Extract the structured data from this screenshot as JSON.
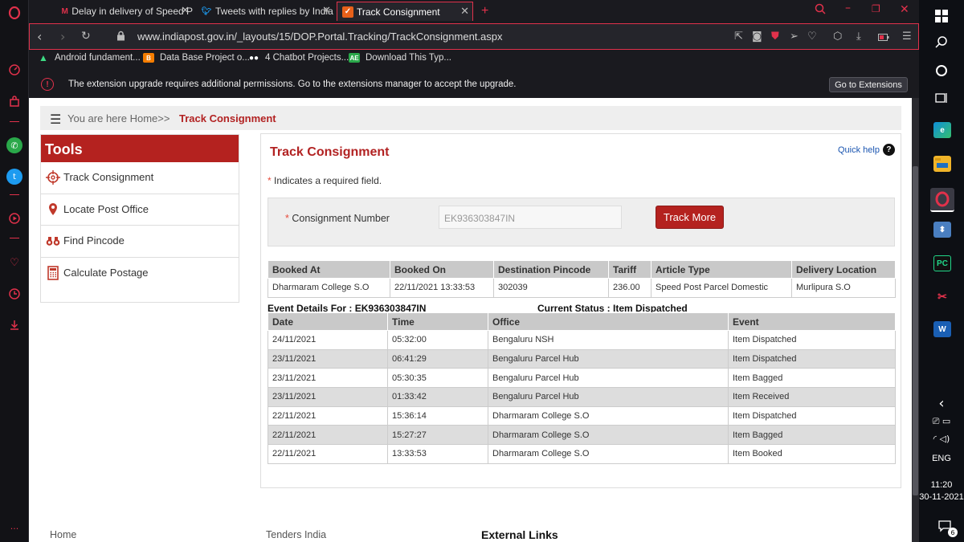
{
  "colors": {
    "accent": "#e1314b",
    "brand_red": "#b4221f",
    "link_blue": "#1a55b0"
  },
  "tabs": [
    {
      "label": "Delay in delivery of Speed P",
      "icon": "gmail-icon"
    },
    {
      "label": "Tweets with replies by India",
      "icon": "twitter-icon"
    },
    {
      "label": "Track Consignment",
      "icon": "indiapost-icon"
    }
  ],
  "address": {
    "url": "www.indiapost.gov.in/_layouts/15/DOP.Portal.Tracking/TrackConsignment.aspx"
  },
  "bookmarks": [
    {
      "label": "Android fundament...",
      "icon": "android-icon"
    },
    {
      "label": "Data Base Project o...",
      "icon": "blogger-icon"
    },
    {
      "label": "4 Chatbot Projects...",
      "icon": "dots-icon"
    },
    {
      "label": "Download This Typ...",
      "icon": "ae-icon"
    }
  ],
  "notice": {
    "text": "The extension upgrade requires additional permissions. Go to the extensions manager to accept the upgrade.",
    "button": "Go to Extensions"
  },
  "breadcrumb": {
    "prefix": "You are here Home>>",
    "current": "Track Consignment"
  },
  "tools": {
    "title": "Tools",
    "items": [
      "Track Consignment",
      "Locate Post Office",
      "Find Pincode",
      "Calculate Postage"
    ]
  },
  "panel": {
    "title": "Track Consignment",
    "quick_help": "Quick help",
    "required_note": "Indicates a required field.",
    "consignment_label": "Consignment Number",
    "consignment_value": "EK936303847IN",
    "track_button": "Track More"
  },
  "booking": {
    "headers": [
      "Booked At",
      "Booked On",
      "Destination Pincode",
      "Tariff",
      "Article Type",
      "Delivery Location"
    ],
    "row": [
      "Dharmaram College S.O",
      "22/11/2021 13:33:53",
      "302039",
      "236.00",
      "Speed Post Parcel Domestic",
      "Murlipura S.O"
    ]
  },
  "event_details": {
    "label": "Event Details For : EK936303847IN",
    "status": "Current Status : Item Dispatched",
    "headers": [
      "Date",
      "Time",
      "Office",
      "Event"
    ],
    "rows": [
      [
        "24/11/2021",
        "05:32:00",
        "Bengaluru NSH",
        "Item Dispatched"
      ],
      [
        "23/11/2021",
        "06:41:29",
        "Bengaluru Parcel Hub",
        "Item Dispatched"
      ],
      [
        "23/11/2021",
        "05:30:35",
        "Bengaluru Parcel Hub",
        "Item Bagged"
      ],
      [
        "23/11/2021",
        "01:33:42",
        "Bengaluru Parcel Hub",
        "Item Received"
      ],
      [
        "22/11/2021",
        "15:36:14",
        "Dharmaram College S.O",
        "Item Dispatched"
      ],
      [
        "22/11/2021",
        "15:27:27",
        "Dharmaram College S.O",
        "Item Bagged"
      ],
      [
        "22/11/2021",
        "13:33:53",
        "Dharmaram College S.O",
        "Item Booked"
      ]
    ]
  },
  "footer": {
    "home": "Home",
    "tenders": "Tenders India",
    "external": "External Links"
  },
  "tray": {
    "lang": "ENG",
    "time": "11:20",
    "date": "30-11-2021",
    "notif_count": "6"
  }
}
